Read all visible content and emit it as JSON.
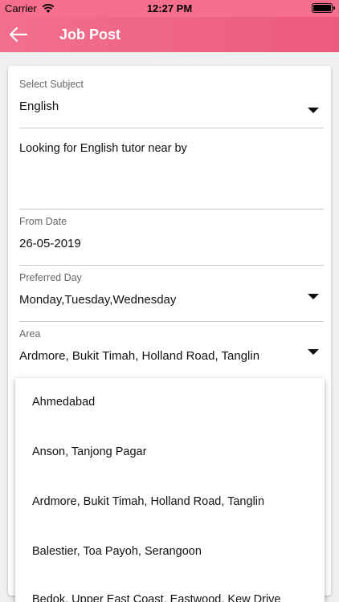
{
  "status": {
    "carrier": "Carrier",
    "time": "12:27 PM"
  },
  "appbar": {
    "title": "Job Post",
    "back_icon": "arrow-left-icon"
  },
  "form": {
    "subject": {
      "label": "Select Subject",
      "value": "English"
    },
    "description": {
      "value": "Looking for English tutor near by"
    },
    "from_date": {
      "label": "From Date",
      "value": "26-05-2019"
    },
    "preferred_day": {
      "label": "Preferred Day",
      "value": "Monday,Tuesday,Wednesday"
    },
    "area": {
      "label": "Area",
      "value": "Ardmore, Bukit Timah, Holland Road, Tanglin"
    }
  },
  "area_options": [
    "Ahmedabad",
    "Anson, Tanjong Pagar",
    "Ardmore, Bukit Timah, Holland Road, Tanglin",
    "Balestier, Toa Payoh, Serangoon",
    "Bedok, Upper East Coast, Eastwood, Kew Drive"
  ],
  "colors": {
    "header": "#ec5b7b",
    "status": "#f66f8c"
  }
}
